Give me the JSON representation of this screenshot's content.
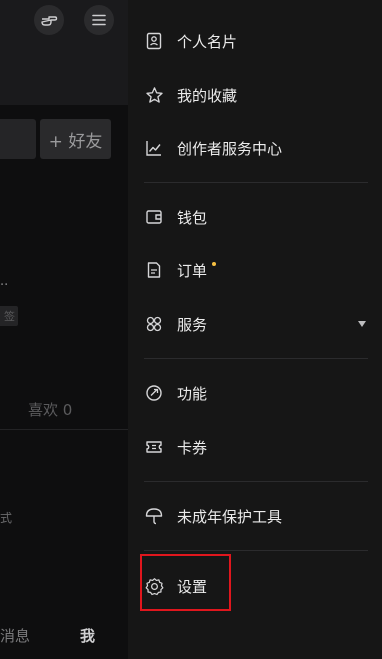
{
  "background": {
    "add_friend": "+ 好友",
    "truncated_text": "..",
    "tag_text": "签",
    "likes_label": "喜欢",
    "likes_count": "0",
    "partial_text": "式",
    "nav": {
      "messages": "消息",
      "me": "我"
    }
  },
  "drawer": {
    "items": [
      {
        "label": "个人名片",
        "icon": "id-card-icon"
      },
      {
        "label": "我的收藏",
        "icon": "star-icon"
      },
      {
        "label": "创作者服务中心",
        "icon": "chart-icon"
      },
      {
        "label": "钱包",
        "icon": "wallet-icon"
      },
      {
        "label": "订单",
        "icon": "order-icon"
      },
      {
        "label": "服务",
        "icon": "services-icon"
      },
      {
        "label": "功能",
        "icon": "function-icon"
      },
      {
        "label": "卡券",
        "icon": "coupon-icon"
      },
      {
        "label": "未成年保护工具",
        "icon": "umbrella-icon"
      },
      {
        "label": "设置",
        "icon": "gear-icon"
      }
    ]
  },
  "colors": {
    "accent_dot": "#f6c042",
    "highlight_border": "#e0161d",
    "drawer_bg": "#161616"
  }
}
